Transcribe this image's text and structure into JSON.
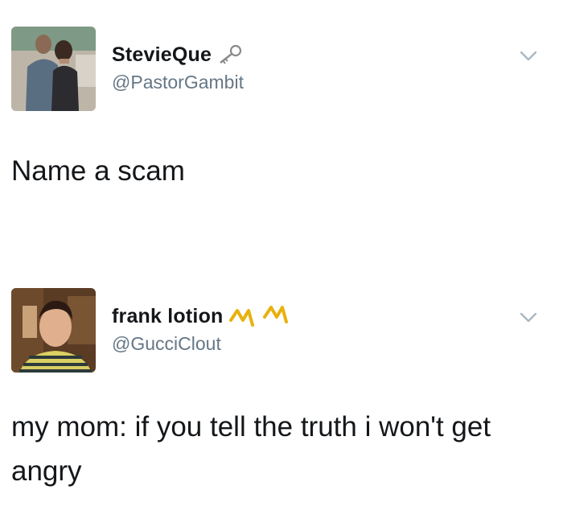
{
  "tweets": [
    {
      "display_name": "StevieQue",
      "handle": "@PastorGambit",
      "name_emoji": "key-icon",
      "text": "Name a scam"
    },
    {
      "display_name": "frank lotion",
      "handle": "@GucciClout",
      "name_emoji": "gold-crown-icons",
      "text": "my mom: if you tell the truth i won't get angry"
    }
  ],
  "colors": {
    "text": "#14171a",
    "handle": "#657786",
    "chevron": "#aab8c2",
    "emoji_gold": "#e8b10d"
  }
}
